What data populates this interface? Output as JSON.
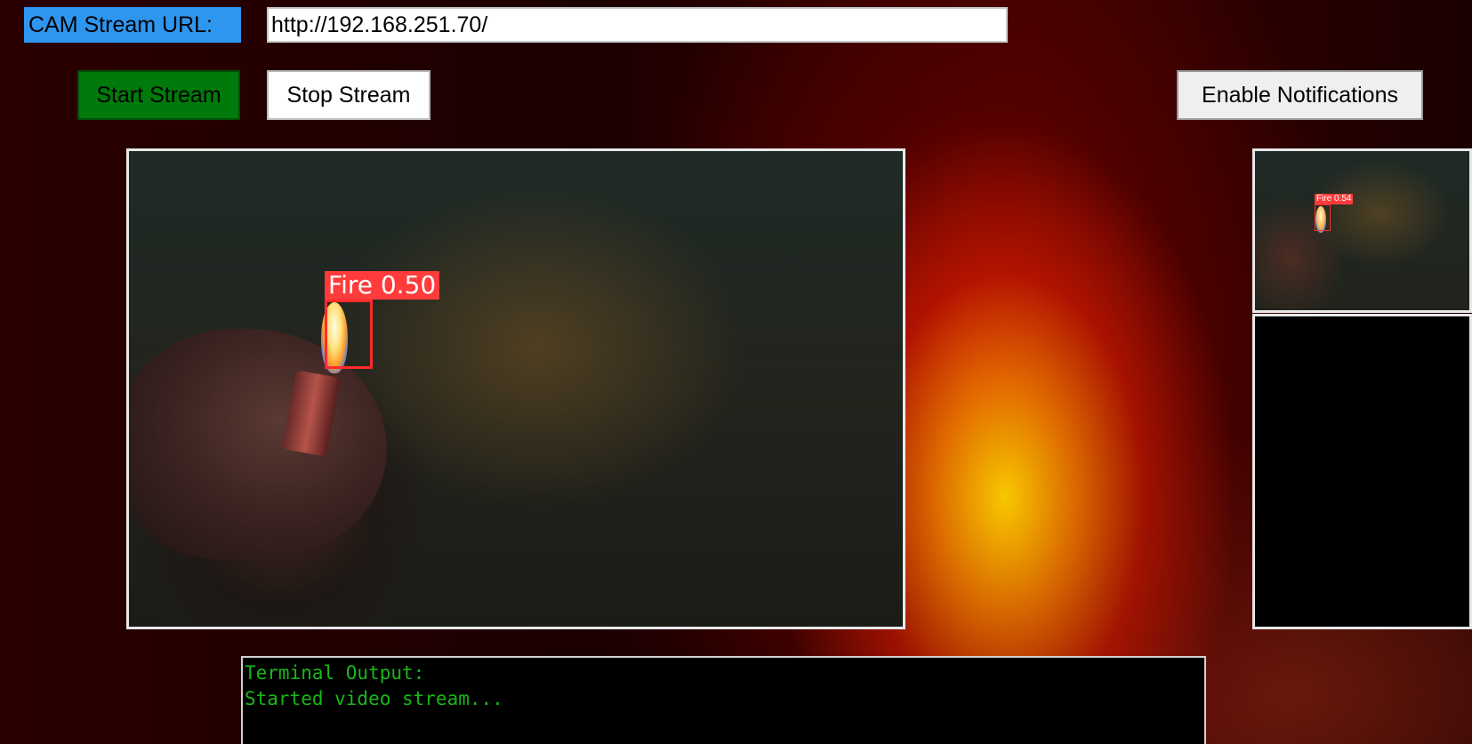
{
  "stream_url": {
    "label": "CAM Stream URL:",
    "value": "http://192.168.251.70/"
  },
  "controls": {
    "start_label": "Start Stream",
    "stop_label": "Stop Stream",
    "notify_label": "Enable Notifications"
  },
  "main_video": {
    "detection_label": "Fire 0.50"
  },
  "thumbnail": {
    "detection_label": "Fire 0.54"
  },
  "terminal": {
    "lines": [
      "Terminal Output:",
      "Started video stream..."
    ]
  },
  "colors": {
    "label_bg": "#2f96f0",
    "start_button_bg": "#007a0a",
    "detection_red": "#ff3b3b",
    "terminal_text": "#18b818"
  }
}
